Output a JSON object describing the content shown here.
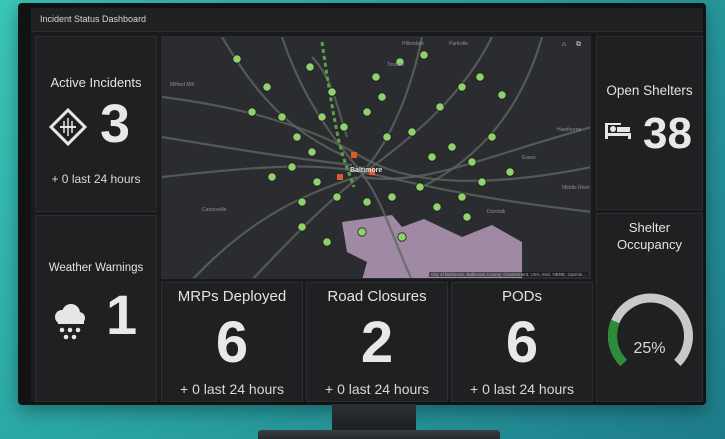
{
  "dashboard": {
    "title": "Incident Status Dashboard"
  },
  "active_incidents": {
    "label": "Active Incidents",
    "value": "3",
    "sub": "+ 0 last 24 hours",
    "icon": "hazard-diamond-icon"
  },
  "weather_warnings": {
    "label": "Weather Warnings",
    "value": "1",
    "icon": "rain-cloud-icon"
  },
  "open_shelters": {
    "label": "Open Shelters",
    "value": "38",
    "icon": "bed-icon"
  },
  "shelter_occupancy": {
    "label_line1": "Shelter",
    "label_line2": "Occupancy",
    "percent_text": "25%",
    "fraction": 0.25,
    "accent": "#2e8b3a"
  },
  "mrps_deployed": {
    "label": "MRPs Deployed",
    "value": "6",
    "sub": "+ 0 last 24 hours"
  },
  "road_closures": {
    "label": "Road Closures",
    "value": "2",
    "sub": "+ 0 last 24 hours"
  },
  "pods": {
    "label": "PODs",
    "value": "6",
    "sub": "+ 0 last 24 hours"
  },
  "map": {
    "city_label": "Baltimore",
    "place_labels": [
      "Hillendale",
      "Parkville",
      "Milford Mill",
      "Towson",
      "Catonsville",
      "Dundalk",
      "Essex",
      "Hawthorne",
      "Middle River"
    ],
    "attribution": "City of Baltimore, Baltimore County, Government, USA, Esri, HERE, Garmin...",
    "marker_color": "#8fd16a",
    "region_color": "#b49ab8",
    "controls": [
      "home-icon",
      "layers-icon"
    ]
  }
}
